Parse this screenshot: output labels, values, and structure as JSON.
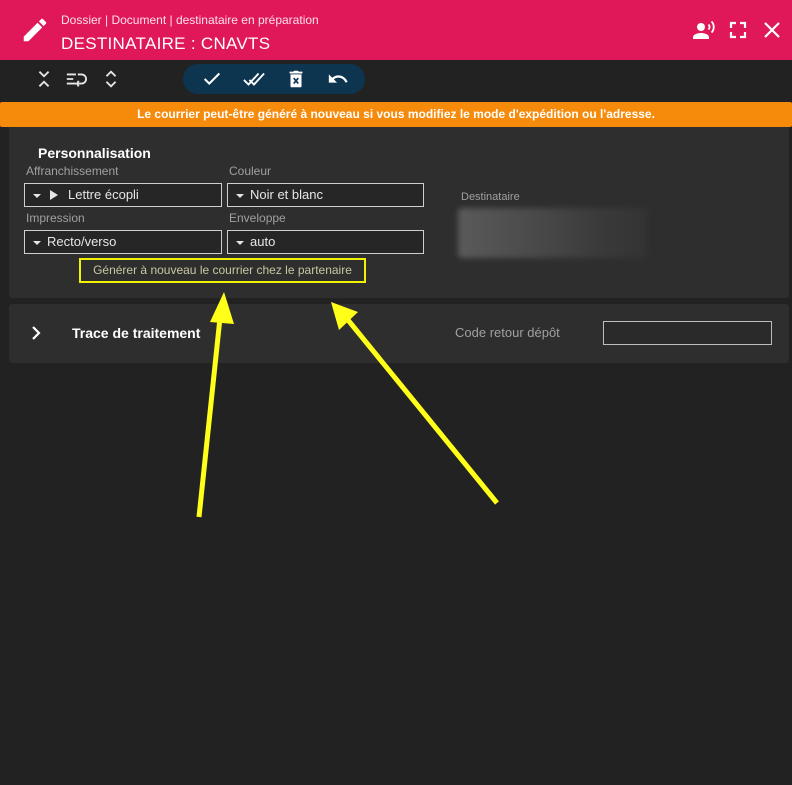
{
  "header": {
    "breadcrumb": "Dossier | Document | destinataire en préparation",
    "title": "DESTINATAIRE : CNAVTS",
    "brand_color": "#e0185a"
  },
  "banner": {
    "text": "Le courrier peut-être généré à nouveau si vous modifiez le mode d'expédition ou l'adresse.",
    "color": "#f68a0a"
  },
  "personnalisation": {
    "title": "Personnalisation",
    "affranchissement": {
      "label": "Affranchissement",
      "value": "Lettre écopli"
    },
    "couleur": {
      "label": "Couleur",
      "value": "Noir et blanc"
    },
    "impression": {
      "label": "Impression",
      "value": "Recto/verso"
    },
    "enveloppe": {
      "label": "Enveloppe",
      "value": "auto"
    },
    "regenerate_button": "Générer à nouveau le courrier chez le partenaire",
    "destinataire_label": "Destinataire"
  },
  "trace": {
    "title": "Trace de traitement",
    "code_retour_label": "Code retour dépôt",
    "code_retour_value": ""
  },
  "icons": {
    "header": [
      "edit-icon",
      "speaker-person-icon",
      "fullscreen-icon",
      "close-icon"
    ],
    "toolbar": [
      "collapse-all-icon",
      "list-arrow-icon",
      "expand-all-icon"
    ],
    "actions": [
      "check-icon",
      "double-check-icon",
      "delete-icon",
      "undo-icon"
    ],
    "annotation_color": "#ffff1a"
  }
}
